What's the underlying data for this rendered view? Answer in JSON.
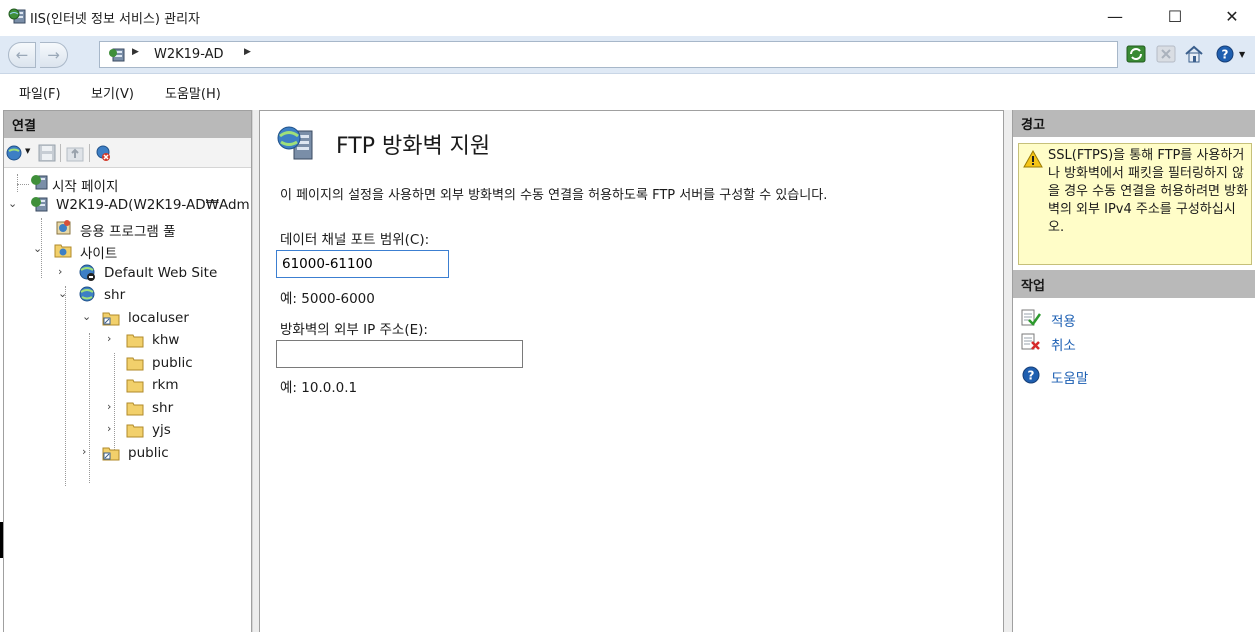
{
  "window": {
    "title": "IIS(인터넷 정보 서비스) 관리자",
    "minimize": "—",
    "maximize": "☐",
    "close": "✕"
  },
  "address": {
    "path": "W2K19-AD"
  },
  "menu": {
    "file": "파일(F)",
    "view": "보기(V)",
    "help": "도움말(H)"
  },
  "connections": {
    "header": "연결",
    "tree": [
      {
        "label": "시작 페이지",
        "icon": "start-page-icon"
      },
      {
        "label": "W2K19-AD(W2K19-AD₩Adm",
        "icon": "server-icon"
      },
      {
        "label": "응용 프로그램 풀",
        "icon": "app-pool-icon"
      },
      {
        "label": "사이트",
        "icon": "sites-folder-icon"
      },
      {
        "label": "Default Web Site",
        "icon": "globe-stopped-icon"
      },
      {
        "label": "shr",
        "icon": "globe-icon"
      },
      {
        "label": "localuser",
        "icon": "virtual-folder-icon"
      },
      {
        "label": "khw",
        "icon": "folder-icon"
      },
      {
        "label": "public",
        "icon": "folder-icon"
      },
      {
        "label": "rkm",
        "icon": "folder-icon"
      },
      {
        "label": "shr",
        "icon": "folder-icon"
      },
      {
        "label": "yjs",
        "icon": "folder-icon"
      },
      {
        "label": "public",
        "icon": "virtual-folder-icon"
      }
    ]
  },
  "main": {
    "title": "FTP 방화벽 지원",
    "description": "이 페이지의 설정을 사용하면 외부 방화벽의 수동 연결을 허용하도록 FTP 서버를 구성할 수 있습니다.",
    "port_range_label": "데이터 채널 포트 범위(C):",
    "port_range_value": "61000-61100",
    "port_range_example": "예: 5000-6000",
    "external_ip_label": "방화벽의 외부 IP 주소(E):",
    "external_ip_value": "",
    "external_ip_example": "예: 10.0.0.1"
  },
  "alerts": {
    "header": "경고",
    "message": "SSL(FTPS)을 통해 FTP를 사용하거나 방화벽에서 패킷을 필터링하지 않을 경우 수동 연결을 허용하려면 방화벽의 외부 IPv4 주소를 구성하십시오."
  },
  "actions": {
    "header": "작업",
    "apply": "적용",
    "cancel": "취소",
    "help": "도움말"
  },
  "colors": {
    "accent_link": "#1c5fb3",
    "header_gray": "#b9b9b9",
    "alert_bg": "#fffdc8"
  }
}
